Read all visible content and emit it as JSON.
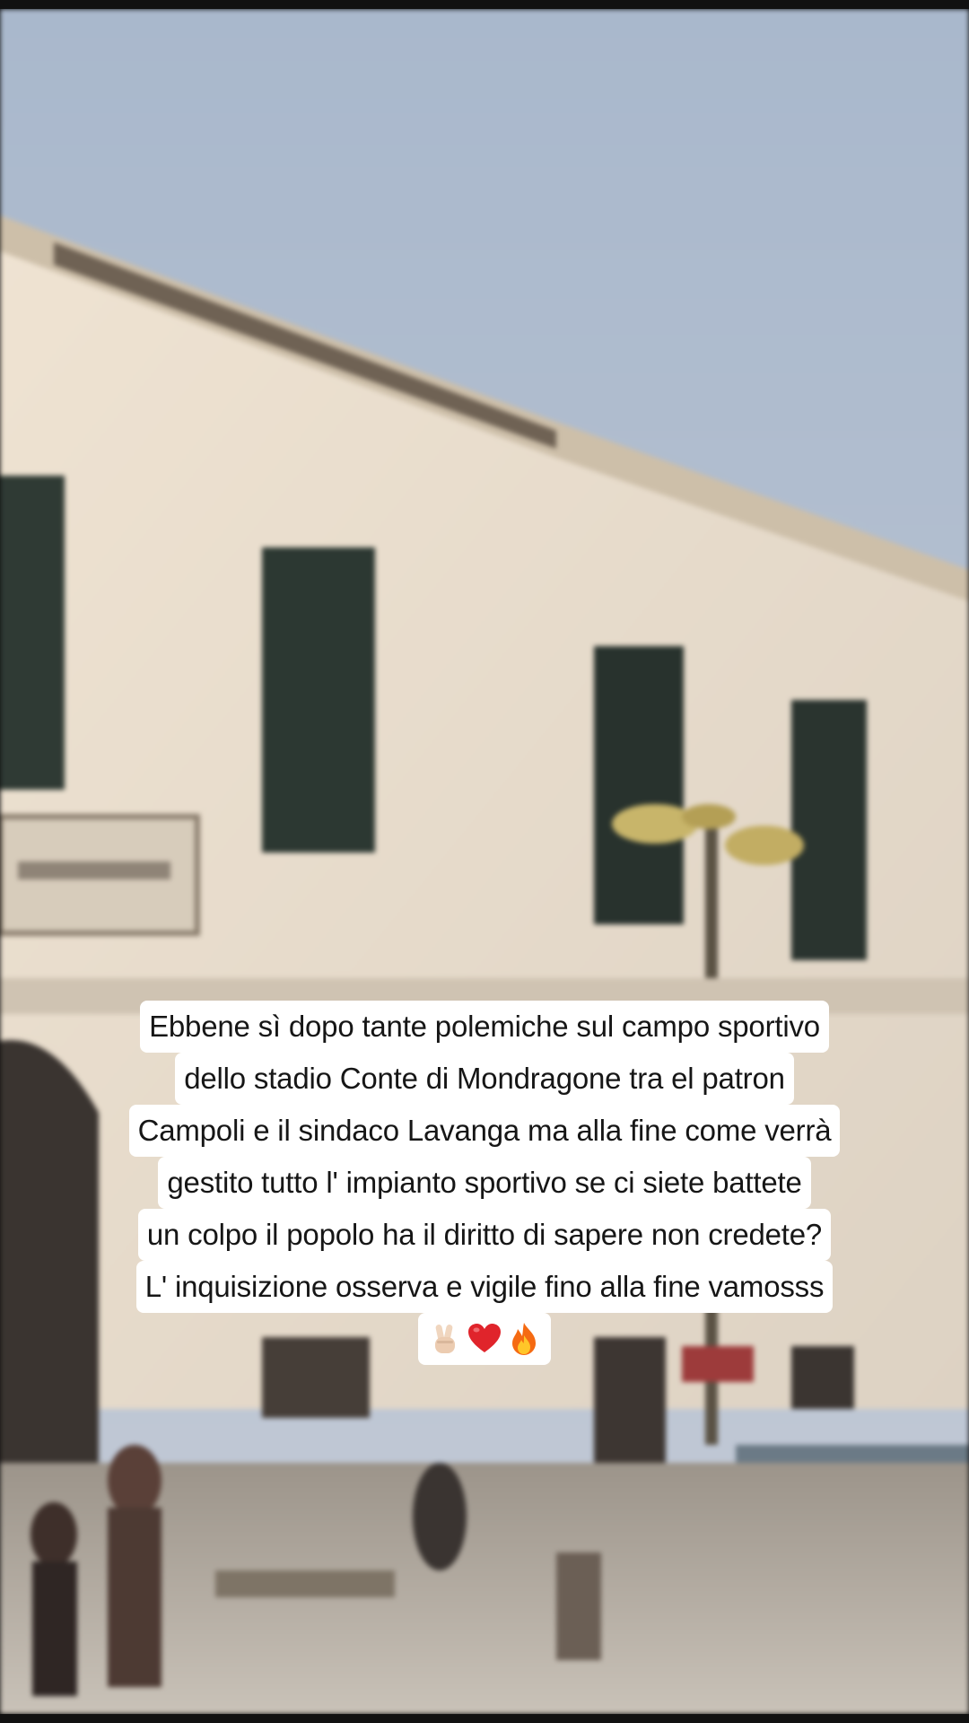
{
  "caption": {
    "lines": [
      "Ebbene sì dopo tante polemiche sul campo sportivo",
      "dello stadio Conte di Mondragone tra el patron",
      "Campoli e il sindaco Lavanga ma alla fine come verrà",
      "gestito tutto l' impianto sportivo se ci siete battete",
      "un colpo il popolo ha il diritto di sapere non credete?",
      "L' inquisizione osserva e vigile fino alla fine vamosss"
    ],
    "emojis": [
      "victory-hand-icon",
      "red-heart-icon",
      "fire-icon"
    ]
  },
  "colors": {
    "sky": "#aebdd0",
    "facade": "#e7dccb",
    "caption_bg": "#ffffff",
    "caption_text": "#161616"
  }
}
